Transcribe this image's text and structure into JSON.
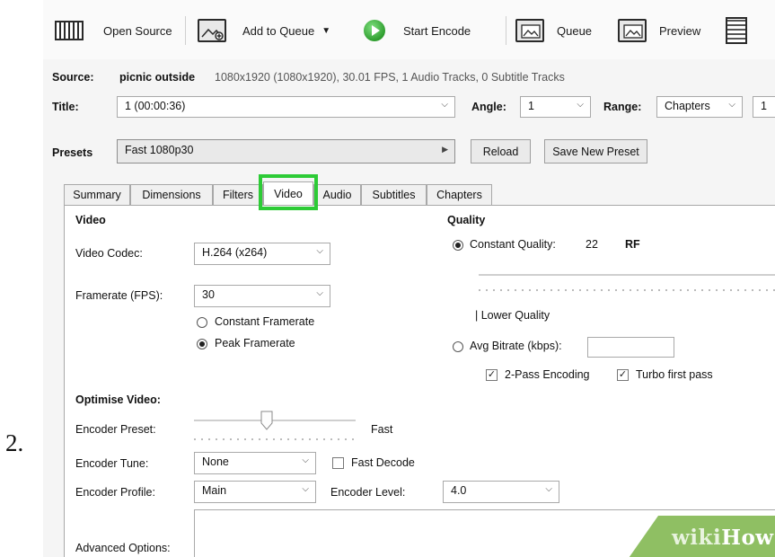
{
  "step_number": "2.",
  "toolbar": {
    "open_source": "Open Source",
    "add_to_queue": "Add to Queue",
    "start_encode": "Start Encode",
    "queue": "Queue",
    "preview": "Preview"
  },
  "source": {
    "label": "Source:",
    "name": "picnic outside",
    "details": "1080x1920 (1080x1920), 30.01 FPS, 1 Audio Tracks, 0 Subtitle Tracks"
  },
  "title_row": {
    "label": "Title:",
    "value": "1 (00:00:36)",
    "angle_label": "Angle:",
    "angle_value": "1",
    "range_label": "Range:",
    "range_value": "Chapters",
    "range_start": "1"
  },
  "presets": {
    "label": "Presets",
    "value": "Fast 1080p30",
    "reload": "Reload",
    "save_new": "Save New Preset"
  },
  "tabs": [
    "Summary",
    "Dimensions",
    "Filters",
    "Video",
    "Audio",
    "Subtitles",
    "Chapters"
  ],
  "active_tab": "Video",
  "video": {
    "heading": "Video",
    "codec_label": "Video Codec:",
    "codec_value": "H.264 (x264)",
    "framerate_label": "Framerate (FPS):",
    "framerate_value": "30",
    "constant_framerate": "Constant Framerate",
    "peak_framerate": "Peak Framerate",
    "framerate_mode": "Peak Framerate"
  },
  "quality": {
    "heading": "Quality",
    "constant_quality_label": "Constant Quality:",
    "constant_quality_value": "22",
    "rf": "RF",
    "lower_quality": "| Lower Quality",
    "avg_bitrate_label": "Avg Bitrate (kbps):",
    "avg_bitrate_value": "",
    "two_pass": "2-Pass Encoding",
    "turbo": "Turbo first pass",
    "mode": "Constant Quality"
  },
  "optimise": {
    "heading": "Optimise Video:",
    "preset_label": "Encoder Preset:",
    "preset_value": "Fast",
    "tune_label": "Encoder Tune:",
    "tune_value": "None",
    "fast_decode": "Fast Decode",
    "profile_label": "Encoder Profile:",
    "profile_value": "Main",
    "level_label": "Encoder Level:",
    "level_value": "4.0",
    "advanced_label": "Advanced Options:"
  },
  "watermark": {
    "part1": "wiki",
    "part2": "How"
  },
  "colors": {
    "highlight": "#2dcb36",
    "start_green": "#2e9d2e",
    "wikihow_green": "#8fbf63"
  }
}
